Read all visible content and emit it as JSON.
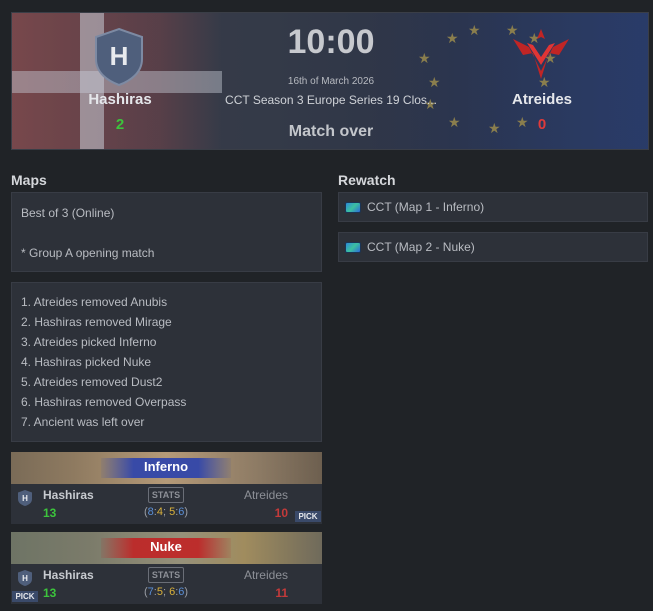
{
  "header": {
    "team_left": {
      "name": "Hashiras",
      "score": "2",
      "logo_letter": "H",
      "logo": "hashiras-shield-logo"
    },
    "team_right": {
      "name": "Atreides",
      "score": "0",
      "logo": "atreides-winged-logo"
    },
    "time": "10:00",
    "date": "16th of March 2026",
    "event": "CCT Season 3 Europe Series 19 Clos...",
    "status": "Match over"
  },
  "maps_section": {
    "title": "Maps",
    "format": "Best of 3 (Online)",
    "note": "* Group A opening match",
    "veto": [
      "1. Atreides removed Anubis",
      "2. Hashiras removed Mirage",
      "3. Atreides picked Inferno",
      "4. Hashiras picked Nuke",
      "5. Atreides removed Dust2",
      "6. Hashiras removed Overpass",
      "7. Ancient was left over"
    ],
    "results": [
      {
        "map": "Inferno",
        "team_left": "Hashiras",
        "score_left": "13",
        "team_right": "Atreides",
        "score_right": "10",
        "stats_label": "STATS",
        "halves": {
          "open": "(",
          "h1a": "8",
          "sep1": ":",
          "h1b": "4",
          "mid": "; ",
          "h2a": "5",
          "sep2": ":",
          "h2b": "6",
          "close": ")"
        },
        "pick_label": "PICK",
        "picked_by": "right"
      },
      {
        "map": "Nuke",
        "team_left": "Hashiras",
        "score_left": "13",
        "team_right": "Atreides",
        "score_right": "11",
        "stats_label": "STATS",
        "halves": {
          "open": "(",
          "h1a": "7",
          "sep1": ":",
          "h1b": "5",
          "mid": "; ",
          "h2a": "6",
          "sep2": ":",
          "h2b": "6",
          "close": ")"
        },
        "pick_label": "PICK",
        "picked_by": "left"
      }
    ]
  },
  "rewatch_section": {
    "title": "Rewatch",
    "items": [
      {
        "label": "CCT (Map 1 - Inferno)",
        "icon": "stream-flag-icon"
      },
      {
        "label": "CCT (Map 2 - Nuke)",
        "icon": "stream-flag-icon"
      }
    ]
  },
  "colors": {
    "background": "#202327",
    "panel": "#2d3139",
    "win": "#3cc43c",
    "loss": "#e03a3a",
    "ct": "#5b8fd6",
    "t": "#d9b13a"
  }
}
